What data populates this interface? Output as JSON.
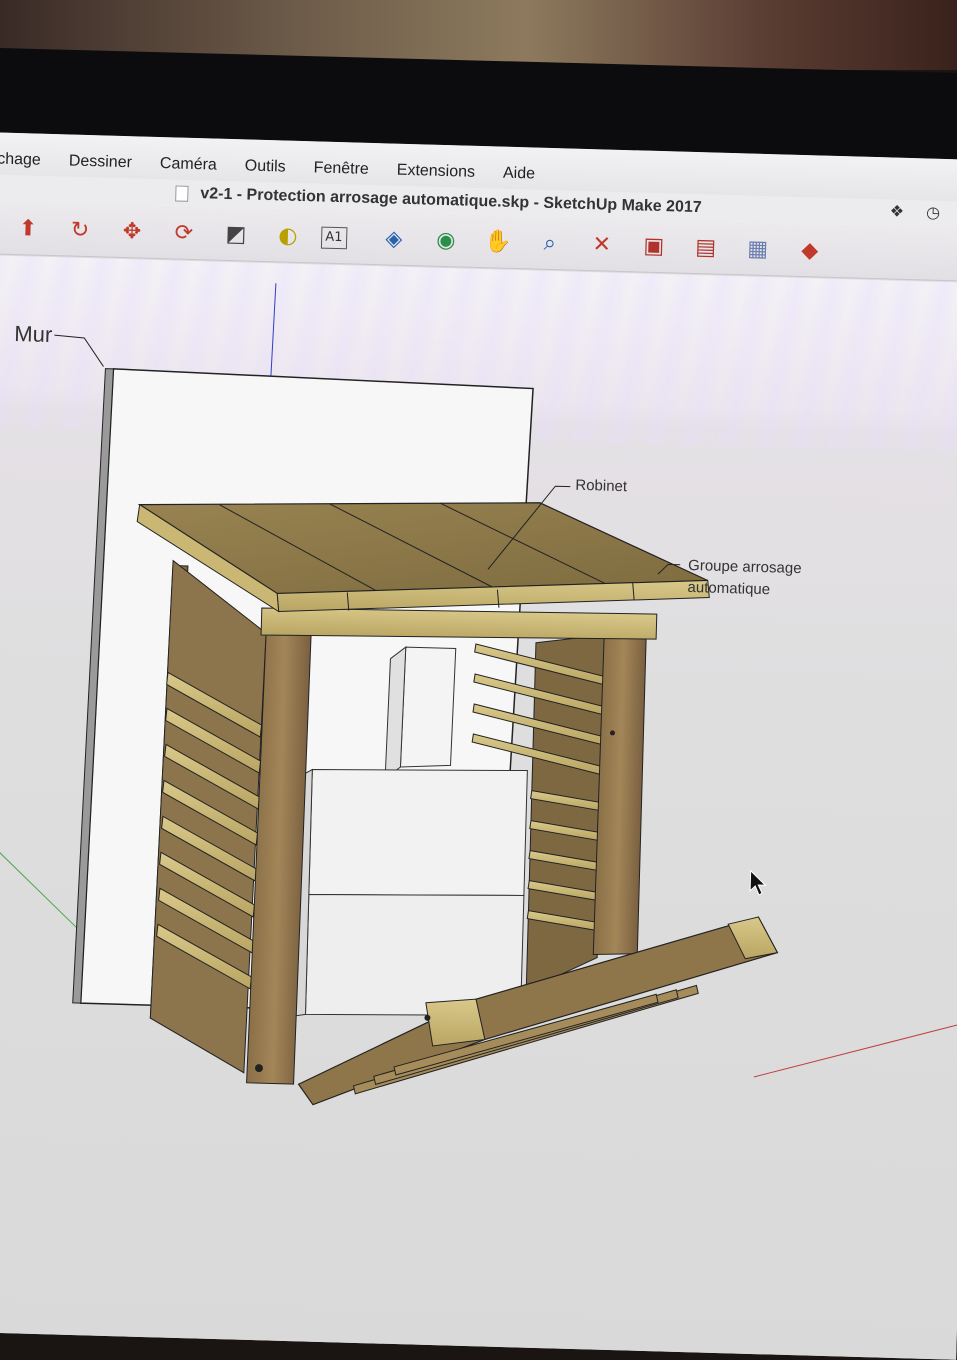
{
  "menu": {
    "items": [
      "chage",
      "Dessiner",
      "Caméra",
      "Outils",
      "Fenêtre",
      "Extensions",
      "Aide"
    ]
  },
  "window": {
    "title": "v2-1 - Protection arrosage automatique.skp - SketchUp Make 2017"
  },
  "status_icons": [
    "dropbox-icon",
    "time-machine-icon"
  ],
  "toolbar": {
    "tools": [
      {
        "name": "push-pull-icon",
        "glyph": "⬆",
        "color": "#c0392b"
      },
      {
        "name": "follow-me-icon",
        "glyph": "↻",
        "color": "#c0392b"
      },
      {
        "name": "move-icon",
        "glyph": "✥",
        "color": "#c0392b"
      },
      {
        "name": "rotate-icon",
        "glyph": "⟳",
        "color": "#c0392b"
      },
      {
        "name": "scale-icon",
        "glyph": "◩",
        "color": "#444444"
      },
      {
        "name": "tape-measure-icon",
        "glyph": "◐",
        "color": "#b8a000"
      },
      {
        "name": "text-icon",
        "glyph": "A1",
        "color": "#333333"
      },
      {
        "name": "paint-bucket-icon",
        "glyph": "◈",
        "color": "#2a62b0"
      },
      {
        "name": "orbit-icon",
        "glyph": "◉",
        "color": "#2a8f4a"
      },
      {
        "name": "pan-icon",
        "glyph": "✋",
        "color": "#c9a36a"
      },
      {
        "name": "zoom-icon",
        "glyph": "⌕",
        "color": "#2a62b0"
      },
      {
        "name": "zoom-extents-icon",
        "glyph": "✕",
        "color": "#c0392b"
      },
      {
        "name": "warehouse-icon",
        "glyph": "▣",
        "color": "#b0322b"
      },
      {
        "name": "share-model-icon",
        "glyph": "▤",
        "color": "#b0322b"
      },
      {
        "name": "layout-icon",
        "glyph": "▦",
        "color": "#6a7fb0"
      },
      {
        "name": "extension-warehouse-icon",
        "glyph": "◆",
        "color": "#c0392b"
      }
    ]
  },
  "annotations": {
    "mur": "Mur",
    "robinet": "Robinet",
    "groupe_line1": "Groupe arrosage",
    "groupe_line2": "automatique"
  }
}
